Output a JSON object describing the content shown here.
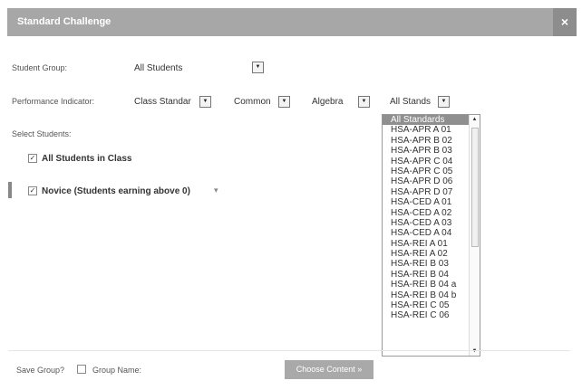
{
  "dialog": {
    "title": "Standard Challenge",
    "close_glyph": "×"
  },
  "student_group": {
    "label": "Student Group:",
    "value": "All Students"
  },
  "performance": {
    "label": "Performance Indicator:",
    "dropdowns": [
      "Class Standar",
      "Common",
      "Algebra",
      "All Stands"
    ]
  },
  "select_students": {
    "label": "Select Students:",
    "all_students": "All Students in Class",
    "novice": "Novice (Students earning above 0)",
    "novice_caret": "▾"
  },
  "standards_list": {
    "selected": "All Standards",
    "items": [
      "All Standards",
      "HSA-APR A 01",
      "HSA-APR B 02",
      "HSA-APR B 03",
      "HSA-APR C 04",
      "HSA-APR C 05",
      "HSA-APR D 06",
      "HSA-APR D 07",
      "HSA-CED A 01",
      "HSA-CED A 02",
      "HSA-CED A 03",
      "HSA-CED A 04",
      "HSA-REI A 01",
      "HSA-REI A 02",
      "HSA-REI B 03",
      "HSA-REI B 04",
      "HSA-REI B 04 a",
      "HSA-REI B 04 b",
      "HSA-REI C 05",
      "HSA-REI C 06"
    ]
  },
  "footer": {
    "save_group_label": "Save Group?",
    "group_name_label": "Group Name:",
    "choose_button": "Choose Content »"
  },
  "icons": {
    "dropdown": "chevron-down-icon",
    "close": "close-icon",
    "check": "check-icon"
  }
}
